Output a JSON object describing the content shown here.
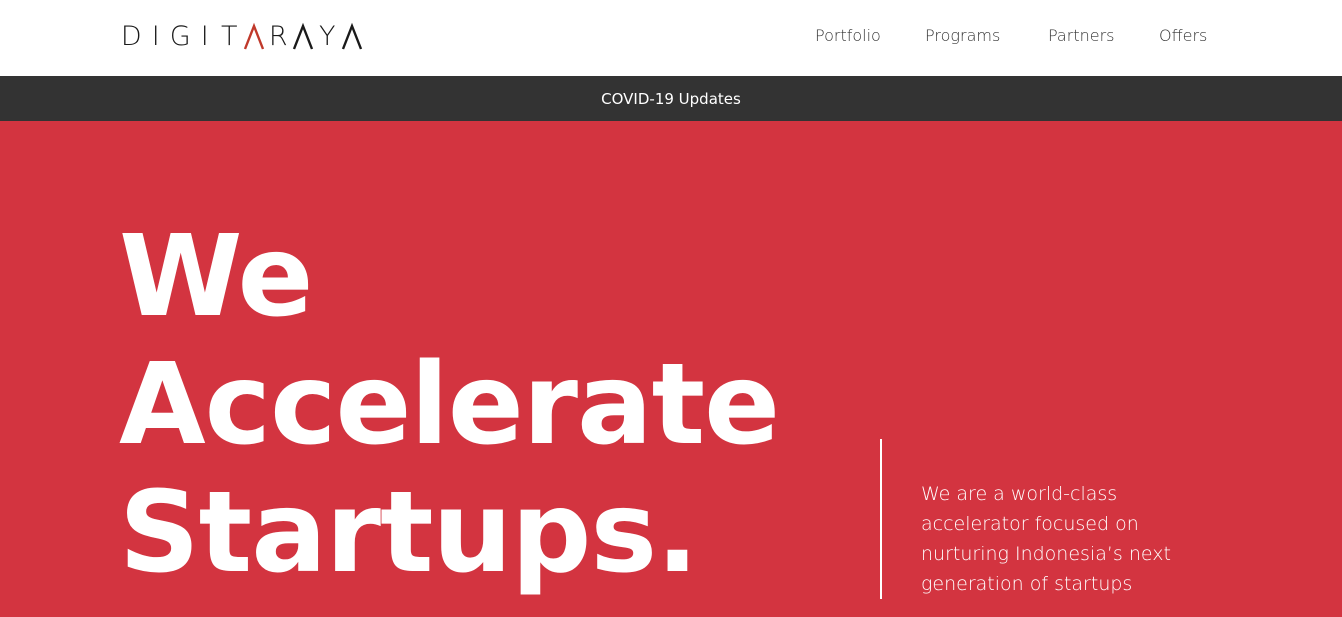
{
  "header": {
    "logo": {
      "letters": [
        "D",
        "I",
        "G",
        "I",
        "T",
        "A",
        "R",
        "A",
        "Y",
        "A"
      ],
      "accent_color": "#c0392b",
      "text_color": "#1a1a1a"
    },
    "nav": [
      {
        "label": "Portfolio"
      },
      {
        "label": "Programs"
      },
      {
        "label": "Partners"
      },
      {
        "label": "Offers"
      }
    ]
  },
  "banner": {
    "label": "COVID-19 Updates",
    "background": "#333333"
  },
  "hero": {
    "background": "#d33440",
    "title_lines": [
      "We",
      "Accelerate",
      "Startups."
    ],
    "description": "We are a world-class accelerator focused on nurturing Indonesia’s next generation of startups"
  }
}
